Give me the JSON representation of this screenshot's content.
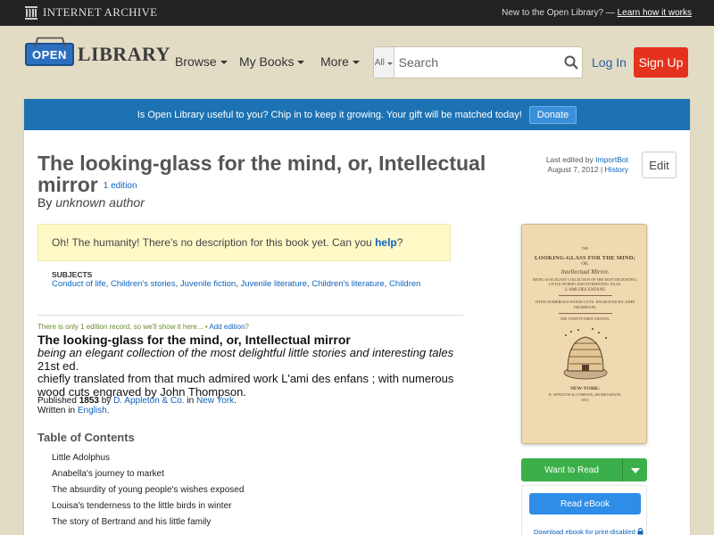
{
  "ia_bar": {
    "logo_text": "INTERNET ARCHIVE",
    "promo_text": "New to the Open Library? —",
    "promo_link": "Learn how it works"
  },
  "header": {
    "logo_open": "OPEN",
    "logo_library": "LIBRARY",
    "nav": [
      {
        "label": "Browse"
      },
      {
        "label": "My Books"
      },
      {
        "label": "More"
      }
    ],
    "search_scope": "All",
    "search_placeholder": "Search",
    "login_label": "Log In",
    "signup_label": "Sign Up"
  },
  "banner": {
    "text": "Is Open Library useful to you? Chip in to keep it growing. Your gift will be matched today!",
    "button": "Donate"
  },
  "work": {
    "title": "The looking-glass for the mind, or, Intellectual mirror",
    "edition_count": "1 edition",
    "by_label": "By",
    "author": "unknown author",
    "last_edited_label": "Last edited by",
    "last_edited_user": "ImportBot",
    "last_edited_date": "August 7, 2012 |",
    "history_link": "History",
    "edit_button": "Edit",
    "no_description": "Oh! The humanity! There's no description for this book yet. Can you",
    "help_link": "help",
    "no_description_end": "?",
    "subjects_label": "SUBJECTS",
    "subjects": [
      "Conduct of life",
      "Children's stories",
      "Juvenile fiction",
      "Juvenile literature",
      "Children's literature",
      "Children"
    ]
  },
  "edition": {
    "note": "There is only 1 edition record, so we'll show it here... •",
    "add_edition": "Add edition",
    "add_edition_suffix": "?",
    "title": "The looking-glass for the mind, or, Intellectual mirror",
    "subtitle": "being an elegant collection of the most delightful little stories and interesting tales",
    "edition_name": "21st ed.",
    "note_text": "chiefly translated from that much admired work L'ami des enfans ; with numerous wood cuts engraved by John Thompson.",
    "published_label": "Published",
    "year": "1853",
    "by": "by",
    "publisher": "D. Appleton & Co.",
    "in": "in",
    "place": "New York",
    "written_label": "Written in",
    "language": "English"
  },
  "toc": {
    "heading": "Table of Contents",
    "items": [
      "Little Adolphus",
      "Anabella's journey to market",
      "The absurdity of young people's wishes exposed",
      "Louisa's tenderness to the little birds in winter",
      "The story of Bertrand and his little family"
    ]
  },
  "cover": {
    "line1": "THE",
    "line2": "LOOKING-GLASS FOR THE MIND;",
    "line3": "OR,",
    "line4": "Intellectual Mirror.",
    "line5": "BEING AN ELEGANT COLLECTION OF THE MOST DELIGHTFUL LITTLE STORIES AND INTERESTING TALES.",
    "line6": "L'AMI DES ENFANS",
    "line7": "WITH NUMEROUS WOOD CUTS. ENGRAVED BY JOHN THOMPSON.",
    "line8": "THE TWENTY-FIRST EDITION.",
    "line9": "NEW-YORK:",
    "line10": "D. APPLETON & COMPANY, 200 BROADWAY.",
    "line11": "1853."
  },
  "actions": {
    "want_to_read": "Want to Read",
    "read_ebook": "Read eBook",
    "download": "Download ebook for print-disabled"
  }
}
